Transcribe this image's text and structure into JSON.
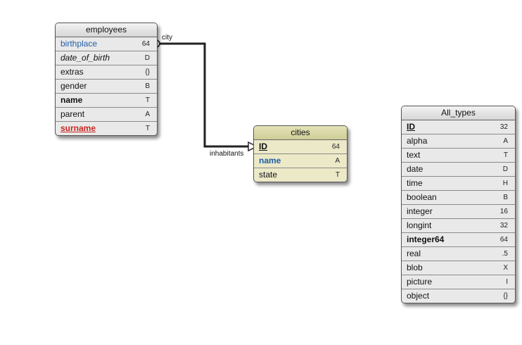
{
  "tables": {
    "employees": {
      "title": "employees",
      "fields": [
        {
          "name": "birthplace",
          "type": "64"
        },
        {
          "name": "date_of_birth",
          "type": "D"
        },
        {
          "name": "extras",
          "type": "{}"
        },
        {
          "name": "gender",
          "type": "B"
        },
        {
          "name": "name",
          "type": "T"
        },
        {
          "name": "parent",
          "type": "A"
        },
        {
          "name": "surname",
          "type": "T"
        }
      ]
    },
    "cities": {
      "title": "cities",
      "fields": [
        {
          "name": "ID",
          "type": "64"
        },
        {
          "name": "name",
          "type": "A"
        },
        {
          "name": "state",
          "type": "T"
        }
      ]
    },
    "all_types": {
      "title": "All_types",
      "fields": [
        {
          "name": "ID",
          "type": "32"
        },
        {
          "name": "alpha",
          "type": "A"
        },
        {
          "name": "text",
          "type": "T"
        },
        {
          "name": "date",
          "type": "D"
        },
        {
          "name": "time",
          "type": "H"
        },
        {
          "name": "boolean",
          "type": "B"
        },
        {
          "name": "integer",
          "type": "16"
        },
        {
          "name": "longint",
          "type": "32"
        },
        {
          "name": "integer64",
          "type": "64"
        },
        {
          "name": "real",
          "type": ".5"
        },
        {
          "name": "blob",
          "type": "X"
        },
        {
          "name": "picture",
          "type": "I"
        },
        {
          "name": "object",
          "type": "{}"
        }
      ]
    }
  },
  "relation": {
    "from_label": "city",
    "to_label": "inhabitants"
  },
  "colors": {
    "blue_field": "#1f5ea8",
    "red_field": "#c8261e",
    "cities_header": "#d6d4a3"
  }
}
